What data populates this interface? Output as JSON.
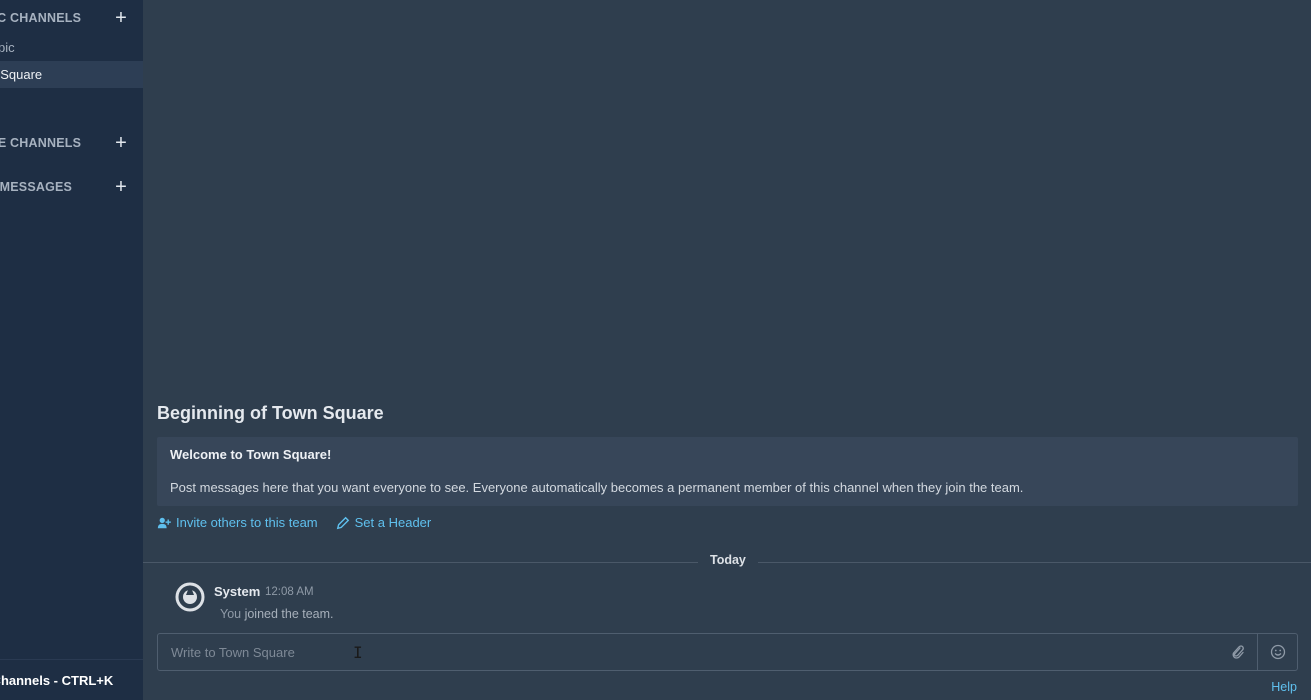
{
  "sidebar": {
    "sections": [
      {
        "label": "PUBLIC CHANNELS",
        "visible_label": "C CHANNELS"
      },
      {
        "label": "PRIVATE CHANNELS",
        "visible_label": "TE CHANNELS"
      },
      {
        "label": "DIRECT MESSAGES",
        "visible_label": "T MESSAGES"
      }
    ],
    "channels": [
      {
        "label": "-Topic"
      },
      {
        "label": "wn Square"
      }
    ],
    "footer": "h Channels - CTRL+K"
  },
  "main": {
    "intro_title": "Beginning of Town Square",
    "welcome": "Welcome to Town Square!",
    "body": "Post messages here that you want everyone to see. Everyone automatically becomes a permanent member of this channel when they join the team.",
    "invite_link": "Invite others to this team",
    "header_link": "Set a Header",
    "date_separator": "Today",
    "post": {
      "user": "System",
      "time": "12:08 AM",
      "message_prefix": "You",
      "message_bold": " joined the team."
    },
    "composer_placeholder": "Write to Town Square",
    "help": "Help"
  },
  "icons": {
    "invite": "add-user-icon",
    "header": "pencil-icon",
    "attach": "paperclip-icon",
    "emoji": "smiley-icon",
    "avatar": "mattermost-logo-icon"
  }
}
